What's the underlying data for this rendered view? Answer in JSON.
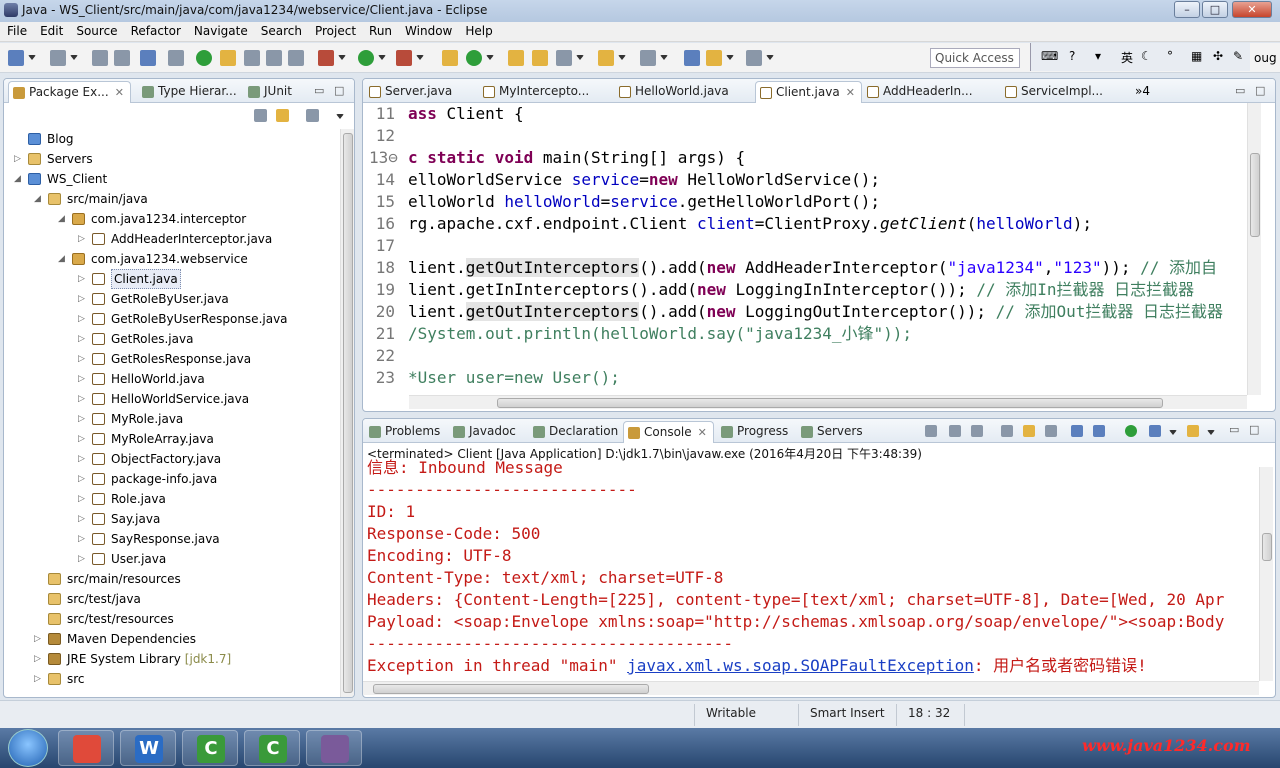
{
  "window": {
    "title": "Java - WS_Client/src/main/java/com/java1234/webservice/Client.java - Eclipse",
    "minimize": "–",
    "maximize": "□",
    "close": "✕"
  },
  "menu": [
    "File",
    "Edit",
    "Source",
    "Refactor",
    "Navigate",
    "Search",
    "Project",
    "Run",
    "Window",
    "Help"
  ],
  "toolbar": {
    "quick_access_placeholder": "Quick Access",
    "ime": {
      "mode": "英",
      "cut": "oug"
    }
  },
  "explorer": {
    "tabs": [
      {
        "label": "Package Ex...",
        "active": true
      },
      {
        "label": "Type Hierar...",
        "active": false
      },
      {
        "label": "JUnit",
        "active": false
      }
    ],
    "tree": [
      {
        "label": "Blog",
        "level": 0,
        "twisty": "",
        "icon": "proj"
      },
      {
        "label": "Servers",
        "level": 0,
        "twisty": "▷",
        "icon": "srcf"
      },
      {
        "label": "WS_Client",
        "level": 0,
        "twisty": "◢",
        "icon": "proj"
      },
      {
        "label": "src/main/java",
        "level": 1,
        "twisty": "◢",
        "icon": "srcf"
      },
      {
        "label": "com.java1234.interceptor",
        "level": 2,
        "twisty": "◢",
        "icon": "pkgi"
      },
      {
        "label": "AddHeaderInterceptor.java",
        "level": 3,
        "twisty": "▷",
        "icon": "java"
      },
      {
        "label": "com.java1234.webservice",
        "level": 2,
        "twisty": "◢",
        "icon": "pkgi"
      },
      {
        "label": "Client.java",
        "level": 3,
        "twisty": "▷",
        "icon": "java",
        "selected": true
      },
      {
        "label": "GetRoleByUser.java",
        "level": 3,
        "twisty": "▷",
        "icon": "java"
      },
      {
        "label": "GetRoleByUserResponse.java",
        "level": 3,
        "twisty": "▷",
        "icon": "java"
      },
      {
        "label": "GetRoles.java",
        "level": 3,
        "twisty": "▷",
        "icon": "java"
      },
      {
        "label": "GetRolesResponse.java",
        "level": 3,
        "twisty": "▷",
        "icon": "java"
      },
      {
        "label": "HelloWorld.java",
        "level": 3,
        "twisty": "▷",
        "icon": "java"
      },
      {
        "label": "HelloWorldService.java",
        "level": 3,
        "twisty": "▷",
        "icon": "java"
      },
      {
        "label": "MyRole.java",
        "level": 3,
        "twisty": "▷",
        "icon": "java"
      },
      {
        "label": "MyRoleArray.java",
        "level": 3,
        "twisty": "▷",
        "icon": "java"
      },
      {
        "label": "ObjectFactory.java",
        "level": 3,
        "twisty": "▷",
        "icon": "java"
      },
      {
        "label": "package-info.java",
        "level": 3,
        "twisty": "▷",
        "icon": "java"
      },
      {
        "label": "Role.java",
        "level": 3,
        "twisty": "▷",
        "icon": "java"
      },
      {
        "label": "Say.java",
        "level": 3,
        "twisty": "▷",
        "icon": "java"
      },
      {
        "label": "SayResponse.java",
        "level": 3,
        "twisty": "▷",
        "icon": "java"
      },
      {
        "label": "User.java",
        "level": 3,
        "twisty": "▷",
        "icon": "java"
      },
      {
        "label": "src/main/resources",
        "level": 1,
        "twisty": "",
        "icon": "srcf"
      },
      {
        "label": "src/test/java",
        "level": 1,
        "twisty": "",
        "icon": "srcf"
      },
      {
        "label": "src/test/resources",
        "level": 1,
        "twisty": "",
        "icon": "srcf"
      },
      {
        "label": "Maven Dependencies",
        "level": 1,
        "twisty": "▷",
        "icon": "lib"
      },
      {
        "label": "JRE System Library",
        "decoration": "[jdk1.7]",
        "level": 1,
        "twisty": "▷",
        "icon": "lib"
      },
      {
        "label": "src",
        "level": 1,
        "twisty": "▷",
        "icon": "srcf"
      }
    ]
  },
  "editor": {
    "tabs": [
      {
        "label": "Server.java",
        "active": false
      },
      {
        "label": "MyIntercepto...",
        "active": false
      },
      {
        "label": "HelloWorld.java",
        "active": false
      },
      {
        "label": "Client.java",
        "active": true
      },
      {
        "label": "AddHeaderIn...",
        "active": false
      },
      {
        "label": "ServiceImpl...",
        "active": false
      }
    ],
    "overflow": "»4",
    "lines": [
      {
        "n": "11",
        "html": "<span class=\"kw\">ass</span> Client {"
      },
      {
        "n": "12",
        "html": ""
      },
      {
        "n": "13⊖",
        "html": "<span class=\"kw\">c static void</span> main(String[] args) {"
      },
      {
        "n": "14",
        "html": "elloWorldService <span class=\"fl\">service</span>=<span class=\"kw\">new</span> HelloWorldService();"
      },
      {
        "n": "15",
        "html": "elloWorld <span class=\"fl\">helloWorld</span>=<span class=\"fl\">service</span>.getHelloWorldPort();"
      },
      {
        "n": "16",
        "html": "rg.apache.cxf.endpoint.Client <span class=\"fl\">client</span>=ClientProxy.<span class=\"it\">getClient</span>(<span class=\"fl\">helloWorld</span>);"
      },
      {
        "n": "17",
        "html": ""
      },
      {
        "n": "18",
        "html": "lient.<span class=\"hl\">getOutInterceptors</span>().add(<span class=\"kw\">new</span> AddHeaderInterceptor(<span class=\"st\">\"java1234\"</span>,<span class=\"st\">\"123\"</span>)); <span class=\"cm\">// 添加自</span>"
      },
      {
        "n": "19",
        "html": "lient.getInInterceptors().add(<span class=\"kw\">new</span> LoggingInInterceptor()); <span class=\"cm\">// 添加In拦截器 日志拦截器</span>"
      },
      {
        "n": "20",
        "html": "lient.<span class=\"hl\">getOutInterceptors</span>().add(<span class=\"kw\">new</span> LoggingOutInterceptor()); <span class=\"cm\">// 添加Out拦截器 日志拦截器</span>"
      },
      {
        "n": "21",
        "html": "<span class=\"cm\">/System.out.println(helloWorld.say(\"java1234_小锋\"));</span>"
      },
      {
        "n": "22",
        "html": ""
      },
      {
        "n": "23",
        "html": "<span class=\"cm\">*User user=new User();</span>"
      }
    ]
  },
  "bottom": {
    "tabs": [
      {
        "label": "Problems",
        "active": false
      },
      {
        "label": "Javadoc",
        "active": false
      },
      {
        "label": "Declaration",
        "active": false
      },
      {
        "label": "Console",
        "active": true
      },
      {
        "label": "Progress",
        "active": false
      },
      {
        "label": "Servers",
        "active": false
      }
    ],
    "console_header": "<terminated> Client [Java Application] D:\\jdk1.7\\bin\\javaw.exe (2016年4月20日 下午3:48:39)",
    "lines": [
      "信息: Inbound Message",
      "----------------------------",
      "ID: 1",
      "Response-Code: 500",
      "Encoding: UTF-8",
      "Content-Type: text/xml; charset=UTF-8",
      "Headers: {Content-Length=[225], content-type=[text/xml; charset=UTF-8], Date=[Wed, 20 Apr",
      "Payload: <soap:Envelope xmlns:soap=\"http://schemas.xmlsoap.org/soap/envelope/\"><soap:Body",
      "--------------------------------------"
    ],
    "exception": {
      "prefix": "Exception in thread \"main\" ",
      "link": "javax.xml.ws.soap.SOAPFaultException",
      "suffix": ": 用户名或者密码错误!"
    }
  },
  "status": {
    "writable": "Writable",
    "insert_mode": "Smart Insert",
    "position": "18 : 32"
  },
  "taskbar": {
    "apps": [
      {
        "name": "chrome",
        "glyph": "",
        "color": "#e04a3a"
      },
      {
        "name": "word",
        "glyph": "W",
        "color": "#2b6cc4"
      },
      {
        "name": "camtasia-1",
        "glyph": "C",
        "color": "#3a9a3a"
      },
      {
        "name": "camtasia-2",
        "glyph": "C",
        "color": "#3a9a3a"
      },
      {
        "name": "javaee",
        "glyph": "",
        "color": "#7a5a9a"
      }
    ],
    "watermark": "www.java1234.com"
  }
}
